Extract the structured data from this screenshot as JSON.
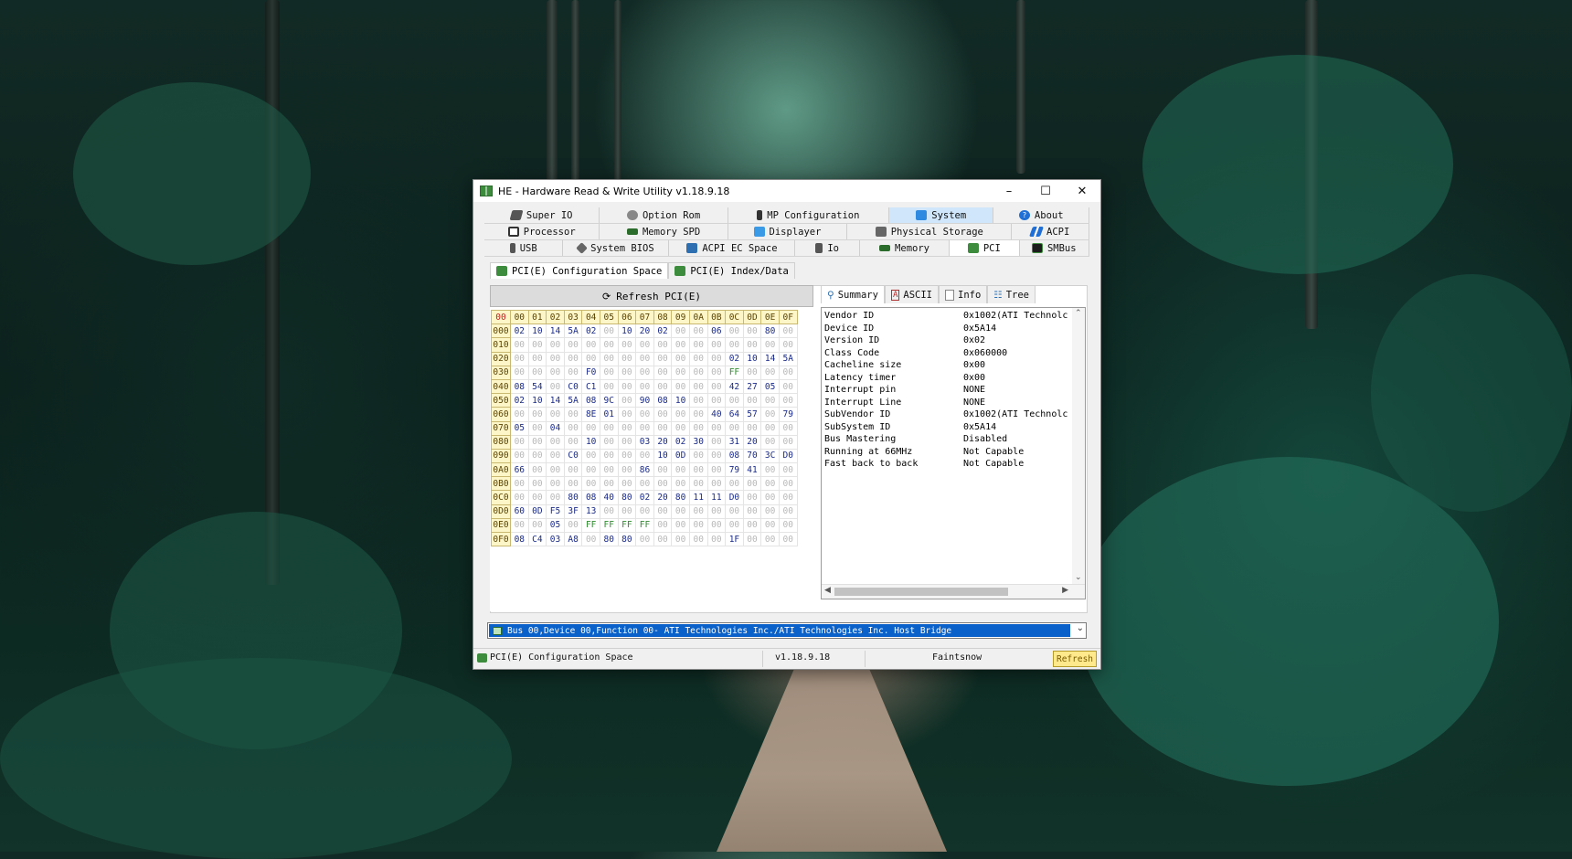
{
  "window": {
    "title": "HE - Hardware Read & Write Utility v1.18.9.18",
    "minimize_icon": "minimize-icon",
    "maximize_icon": "maximize-icon",
    "close_icon": "close-icon"
  },
  "tabs": {
    "row1": [
      {
        "label": "Super IO",
        "icon": "superio-icon"
      },
      {
        "label": "Option Rom",
        "icon": "optionrom-icon"
      },
      {
        "label": "MP Configuration",
        "icon": "mp-icon"
      },
      {
        "label": "System",
        "icon": "system-icon"
      },
      {
        "label": "About",
        "icon": "about-icon"
      }
    ],
    "row2": [
      {
        "label": "Processor",
        "icon": "processor-icon"
      },
      {
        "label": "Memory SPD",
        "icon": "memory-spd-icon"
      },
      {
        "label": "Displayer",
        "icon": "displayer-icon"
      },
      {
        "label": "Physical Storage",
        "icon": "storage-icon"
      },
      {
        "label": "ACPI",
        "icon": "acpi-icon"
      }
    ],
    "row3": [
      {
        "label": "USB",
        "icon": "usb-icon"
      },
      {
        "label": "System BIOS",
        "icon": "bios-icon"
      },
      {
        "label": "ACPI EC Space",
        "icon": "ec-icon"
      },
      {
        "label": "Io",
        "icon": "io-icon"
      },
      {
        "label": "Memory",
        "icon": "memory-icon"
      },
      {
        "label": "PCI",
        "icon": "pci-icon"
      },
      {
        "label": "SMBus",
        "icon": "smbus-icon"
      }
    ]
  },
  "subtabs": [
    {
      "label": "PCI(E) Configuration Space"
    },
    {
      "label": "PCI(E) Index/Data"
    }
  ],
  "refresh_pci_label": "Refresh PCI(E)",
  "hex": {
    "corner": "00",
    "columns": [
      "00",
      "01",
      "02",
      "03",
      "04",
      "05",
      "06",
      "07",
      "08",
      "09",
      "0A",
      "0B",
      "0C",
      "0D",
      "0E",
      "0F"
    ],
    "rows": [
      {
        "addr": "000",
        "cells": [
          "02",
          "10",
          "14",
          "5A",
          "02",
          "00",
          "10",
          "20",
          "02",
          "00",
          "00",
          "06",
          "00",
          "00",
          "80",
          "00"
        ]
      },
      {
        "addr": "010",
        "cells": [
          "00",
          "00",
          "00",
          "00",
          "00",
          "00",
          "00",
          "00",
          "00",
          "00",
          "00",
          "00",
          "00",
          "00",
          "00",
          "00"
        ]
      },
      {
        "addr": "020",
        "cells": [
          "00",
          "00",
          "00",
          "00",
          "00",
          "00",
          "00",
          "00",
          "00",
          "00",
          "00",
          "00",
          "02",
          "10",
          "14",
          "5A"
        ]
      },
      {
        "addr": "030",
        "cells": [
          "00",
          "00",
          "00",
          "00",
          "F0",
          "00",
          "00",
          "00",
          "00",
          "00",
          "00",
          "00",
          "FF",
          "00",
          "00",
          "00"
        ]
      },
      {
        "addr": "040",
        "cells": [
          "08",
          "54",
          "00",
          "C0",
          "C1",
          "00",
          "00",
          "00",
          "00",
          "00",
          "00",
          "00",
          "42",
          "27",
          "05",
          "00"
        ]
      },
      {
        "addr": "050",
        "cells": [
          "02",
          "10",
          "14",
          "5A",
          "08",
          "9C",
          "00",
          "90",
          "08",
          "10",
          "00",
          "00",
          "00",
          "00",
          "00",
          "00"
        ]
      },
      {
        "addr": "060",
        "cells": [
          "00",
          "00",
          "00",
          "00",
          "8E",
          "01",
          "00",
          "00",
          "00",
          "00",
          "00",
          "40",
          "64",
          "57",
          "00",
          "79"
        ]
      },
      {
        "addr": "070",
        "cells": [
          "05",
          "00",
          "04",
          "00",
          "00",
          "00",
          "00",
          "00",
          "00",
          "00",
          "00",
          "00",
          "00",
          "00",
          "00",
          "00"
        ]
      },
      {
        "addr": "080",
        "cells": [
          "00",
          "00",
          "00",
          "00",
          "10",
          "00",
          "00",
          "03",
          "20",
          "02",
          "30",
          "00",
          "31",
          "20",
          "00",
          "00"
        ]
      },
      {
        "addr": "090",
        "cells": [
          "00",
          "00",
          "00",
          "C0",
          "00",
          "00",
          "00",
          "00",
          "10",
          "0D",
          "00",
          "00",
          "08",
          "70",
          "3C",
          "D0"
        ]
      },
      {
        "addr": "0A0",
        "cells": [
          "66",
          "00",
          "00",
          "00",
          "00",
          "00",
          "00",
          "86",
          "00",
          "00",
          "00",
          "00",
          "79",
          "41",
          "00",
          "00"
        ]
      },
      {
        "addr": "0B0",
        "cells": [
          "00",
          "00",
          "00",
          "00",
          "00",
          "00",
          "00",
          "00",
          "00",
          "00",
          "00",
          "00",
          "00",
          "00",
          "00",
          "00"
        ]
      },
      {
        "addr": "0C0",
        "cells": [
          "00",
          "00",
          "00",
          "80",
          "08",
          "40",
          "80",
          "02",
          "20",
          "80",
          "11",
          "11",
          "D0",
          "00",
          "00",
          "00"
        ]
      },
      {
        "addr": "0D0",
        "cells": [
          "60",
          "0D",
          "F5",
          "3F",
          "13",
          "00",
          "00",
          "00",
          "00",
          "00",
          "00",
          "00",
          "00",
          "00",
          "00",
          "00"
        ]
      },
      {
        "addr": "0E0",
        "cells": [
          "00",
          "00",
          "05",
          "00",
          "FF",
          "FF",
          "FF",
          "FF",
          "00",
          "00",
          "00",
          "00",
          "00",
          "00",
          "00",
          "00"
        ]
      },
      {
        "addr": "0F0",
        "cells": [
          "08",
          "C4",
          "03",
          "A8",
          "00",
          "80",
          "80",
          "00",
          "00",
          "00",
          "00",
          "00",
          "1F",
          "00",
          "00",
          "00"
        ]
      }
    ]
  },
  "right_tabs": [
    {
      "label": "Summary",
      "icon": "search-icon"
    },
    {
      "label": "ASCII",
      "icon": "ascii-icon"
    },
    {
      "label": "Info",
      "icon": "info-icon"
    },
    {
      "label": "Tree",
      "icon": "tree-icon"
    }
  ],
  "summary": [
    {
      "key": "Vendor ID",
      "value": "0x1002(ATI Technolc"
    },
    {
      "key": "Device ID",
      "value": "0x5A14"
    },
    {
      "key": "Version ID",
      "value": "0x02"
    },
    {
      "key": "Class Code",
      "value": "0x060000"
    },
    {
      "key": "Cacheline size",
      "value": "0x00"
    },
    {
      "key": "Latency timer",
      "value": "0x00"
    },
    {
      "key": "Interrupt pin",
      "value": "NONE"
    },
    {
      "key": "Interrupt Line",
      "value": "NONE"
    },
    {
      "key": "SubVendor ID",
      "value": "0x1002(ATI Technolc"
    },
    {
      "key": "SubSystem ID",
      "value": "0x5A14"
    },
    {
      "key": "Bus Mastering",
      "value": "Disabled"
    },
    {
      "key": "Running at 66MHz",
      "value": "Not Capable"
    },
    {
      "key": "Fast back to back",
      "value": "Not Capable"
    }
  ],
  "device_select": "Bus 00,Device 00,Function 00- ATI Technologies Inc./ATI Technologies Inc. Host Bridge",
  "status": {
    "left": "PCI(E) Configuration Space",
    "version": "v1.18.9.18",
    "author": "Faintsnow",
    "refresh": "Refresh"
  }
}
